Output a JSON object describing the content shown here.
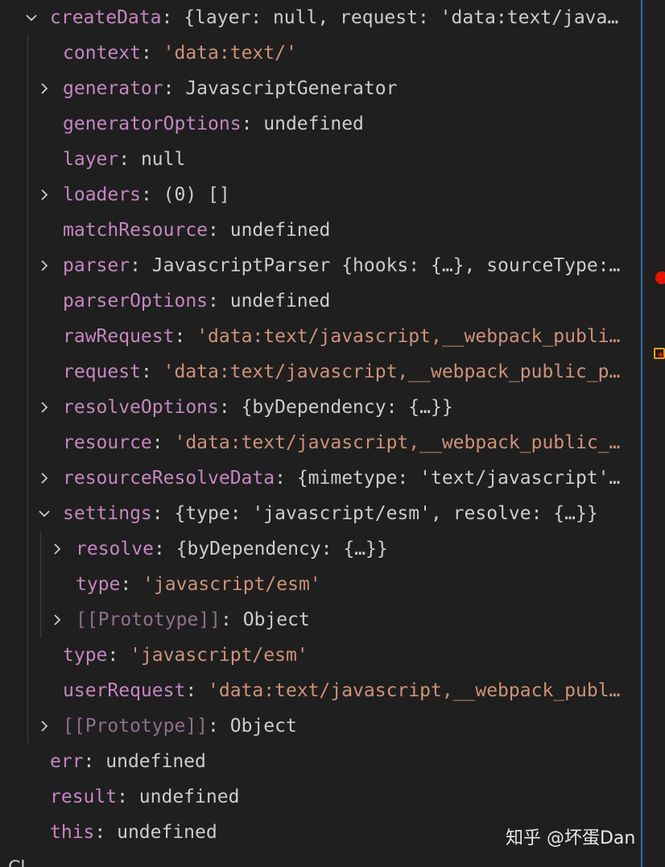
{
  "variables": [
    {
      "key": "createData",
      "value": "{layer: null, request: 'data:text/java…",
      "type": "obj",
      "expanded": true,
      "expandable": true,
      "depth": 0
    },
    {
      "key": "context",
      "value": "'data:text/'",
      "type": "str",
      "depth": 1
    },
    {
      "key": "generator",
      "value": "JavascriptGenerator",
      "type": "obj",
      "expandable": true,
      "depth": 1
    },
    {
      "key": "generatorOptions",
      "value": "undefined",
      "type": "plain",
      "depth": 1
    },
    {
      "key": "layer",
      "value": "null",
      "type": "plain",
      "depth": 1
    },
    {
      "key": "loaders",
      "value": "(0) []",
      "type": "plain",
      "expandable": true,
      "depth": 1
    },
    {
      "key": "matchResource",
      "value": "undefined",
      "type": "plain",
      "depth": 1
    },
    {
      "key": "parser",
      "value": "JavascriptParser {hooks: {…}, sourceType:…",
      "type": "obj",
      "expandable": true,
      "depth": 1
    },
    {
      "key": "parserOptions",
      "value": "undefined",
      "type": "plain",
      "depth": 1
    },
    {
      "key": "rawRequest",
      "value": "'data:text/javascript,__webpack_publi…",
      "type": "str",
      "depth": 1
    },
    {
      "key": "request",
      "value": "'data:text/javascript,__webpack_public_p…",
      "type": "str",
      "depth": 1
    },
    {
      "key": "resolveOptions",
      "value": "{byDependency: {…}}",
      "type": "obj",
      "expandable": true,
      "depth": 1
    },
    {
      "key": "resource",
      "value": "'data:text/javascript,__webpack_public_…",
      "type": "str",
      "depth": 1
    },
    {
      "key": "resourceResolveData",
      "value": "{mimetype: 'text/javascript'…",
      "type": "obj",
      "expandable": true,
      "depth": 1
    },
    {
      "key": "settings",
      "value": "{type: 'javascript/esm', resolve: {…}}",
      "type": "obj",
      "expanded": true,
      "expandable": true,
      "depth": 1
    },
    {
      "key": "resolve",
      "value": "{byDependency: {…}}",
      "type": "obj",
      "expandable": true,
      "depth": 2
    },
    {
      "key": "type",
      "value": "'javascript/esm'",
      "type": "str",
      "depth": 2
    },
    {
      "key": "[[Prototype]]",
      "value": "Object",
      "type": "obj",
      "expandable": true,
      "dim": true,
      "depth": 2
    },
    {
      "key": "type",
      "value": "'javascript/esm'",
      "type": "str",
      "depth": 1
    },
    {
      "key": "userRequest",
      "value": "'data:text/javascript,__webpack_publ…",
      "type": "str",
      "depth": 1
    },
    {
      "key": "[[Prototype]]",
      "value": "Object",
      "type": "obj",
      "expandable": true,
      "dim": true,
      "depth": 1
    },
    {
      "key": "err",
      "value": "undefined",
      "type": "plain",
      "depth": 0
    },
    {
      "key": "result",
      "value": "undefined",
      "type": "plain",
      "depth": 0
    },
    {
      "key": "this",
      "value": "undefined",
      "type": "plain",
      "depth": 0
    }
  ],
  "watermark": "知乎 @坏蛋Dan",
  "next_section_partial": "Cl",
  "colors": {
    "background": "#1f1f1f",
    "key": "#c586c0",
    "string": "#ce9178",
    "value": "#cccccc",
    "breakpoint": "#e51400",
    "divider": "#2f6fb0"
  }
}
